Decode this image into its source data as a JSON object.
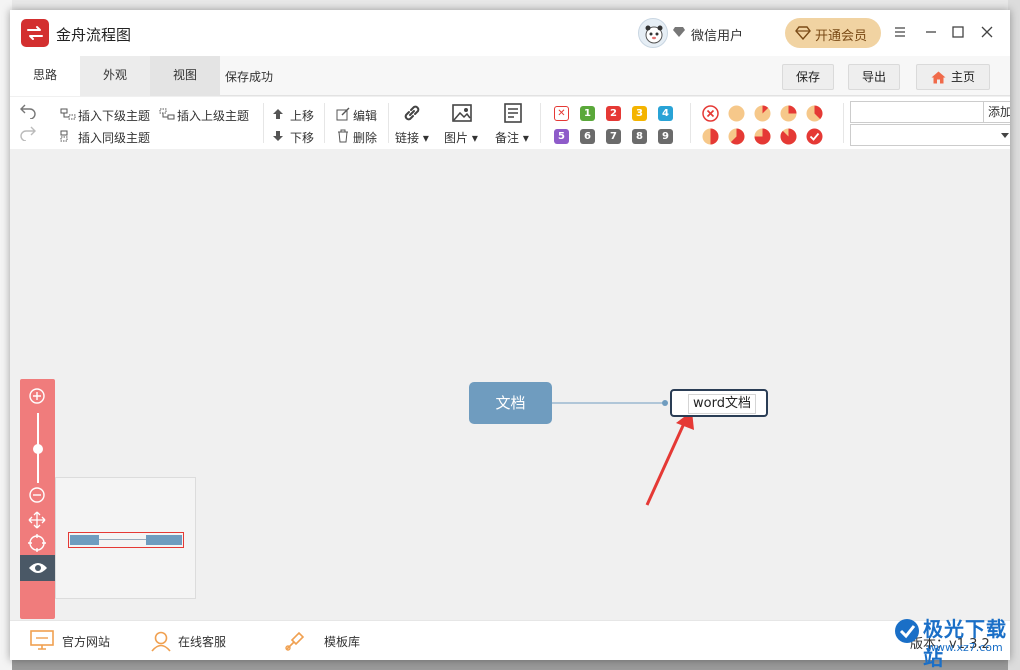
{
  "app": {
    "title": "金舟流程图"
  },
  "account": {
    "username": "微信用户",
    "vip_label": "开通会员"
  },
  "tabs": [
    {
      "label": "思路"
    },
    {
      "label": "外观"
    },
    {
      "label": "视图"
    }
  ],
  "save_status": "保存成功",
  "header_buttons": {
    "save": "保存",
    "export": "导出",
    "home": "主页"
  },
  "toolbar": {
    "insert_child": "插入下级主题",
    "insert_parent": "插入上级主题",
    "insert_sibling": "插入同级主题",
    "move_up": "上移",
    "move_down": "下移",
    "edit": "编辑",
    "delete": "删除",
    "link": "链接",
    "image": "图片",
    "note": "备注",
    "priority_numbers": [
      "1",
      "2",
      "3",
      "4",
      "5",
      "6",
      "7",
      "8",
      "9"
    ],
    "priority_colors": [
      "#5aa83a",
      "#e53935",
      "#f4b400",
      "#29a3d6",
      "#8e5bc9",
      "#6b6b6b",
      "#6b6b6b",
      "#6b6b6b",
      "#6b6b6b"
    ],
    "progress_levels": [
      "cancel",
      "0",
      "1/8",
      "2/8",
      "3/8",
      "4/8",
      "5/8",
      "6/8",
      "7/8",
      "done"
    ],
    "add_label": "添加"
  },
  "mindmap": {
    "root": "文档",
    "child": "word文档",
    "root_color": "#6f9cbf"
  },
  "statusbar": {
    "website": "官方网站",
    "support": "在线客服",
    "templates": "模板库",
    "version": "版本：v1.3.2"
  },
  "watermark": {
    "name": "极光下载站",
    "url": "www.xz7.com"
  },
  "colors": {
    "accent": "#d32f2f",
    "zoom_panel": "#f07c7c",
    "vip": "#f1d3a2"
  }
}
